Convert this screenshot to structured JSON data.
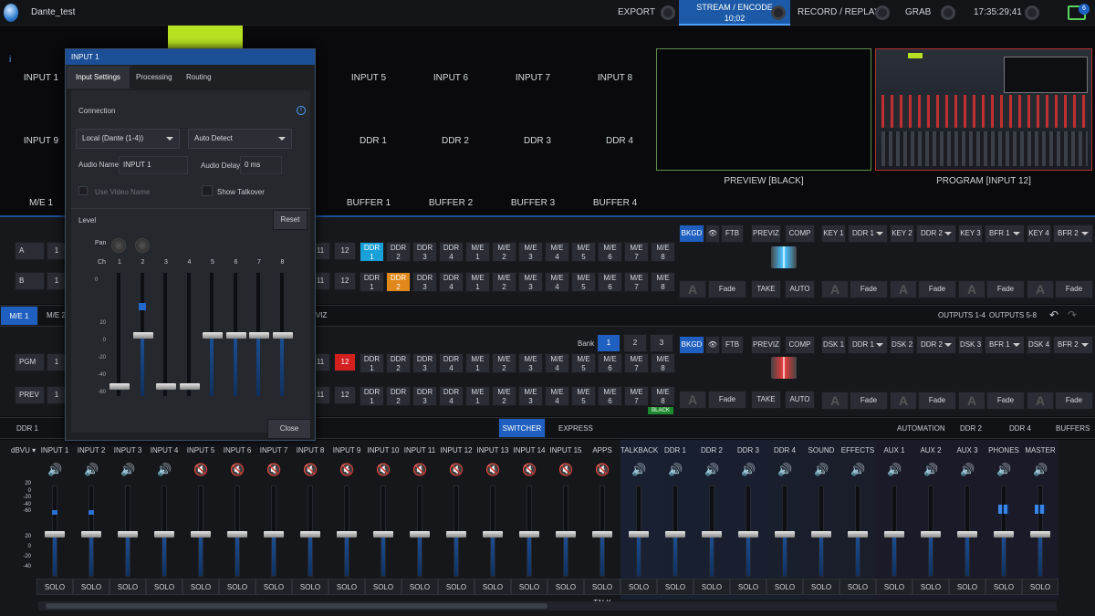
{
  "app": {
    "session": "Dante_test",
    "time": "17:35:29;41",
    "notifications": "6"
  },
  "topbar": {
    "export": "EXPORT",
    "stream_label": "STREAM / ENCODE",
    "stream_time": "10;02",
    "record": "RECORD / REPLAY",
    "grab": "GRAB"
  },
  "inputs_row1": [
    "INPUT 1",
    "INPUT 5",
    "INPUT 6",
    "INPUT 7",
    "INPUT 8"
  ],
  "inputs_row2": [
    "INPUT 9",
    "DDR 1",
    "DDR 2",
    "DDR 3",
    "DDR 4"
  ],
  "buffers": [
    "M/E 1",
    "BUFFER 1",
    "BUFFER 2",
    "BUFFER 3",
    "BUFFER 4"
  ],
  "monitors": {
    "preview": "PREVIEW [BLACK]",
    "program": "PROGRAM [INPUT 12]"
  },
  "dialog": {
    "title": "INPUT 1",
    "tabs": [
      "Input Settings",
      "Processing",
      "Routing"
    ],
    "connection": "Connection",
    "source": "Local (Dante (1-4))",
    "detect": "Auto Detect",
    "audio_name_label": "Audio Name",
    "audio_name": "INPUT 1",
    "audio_delay_label": "Audio Delay",
    "audio_delay": "0 ms",
    "use_video_name": "Use Video Name",
    "show_talkover": "Show Talkover",
    "level": "Level",
    "reset": "Reset",
    "pan": "Pan",
    "ch": "Ch",
    "channels": [
      "1",
      "2",
      "3",
      "4",
      "5",
      "6",
      "7",
      "8"
    ],
    "scale_top": [
      "0"
    ],
    "scale": [
      "20",
      "0",
      "-20",
      "-40",
      "-60"
    ],
    "close": "Close"
  },
  "me": {
    "rowA": "A",
    "rowB": "B",
    "one": "1",
    "eleven": "11",
    "twelve": "12",
    "srcs_top": [
      "DDR",
      "DDR",
      "DDR",
      "DDR",
      "M/E",
      "M/E",
      "M/E",
      "M/E",
      "M/E",
      "M/E",
      "M/E",
      "M/E"
    ],
    "srcs_bot": [
      "1",
      "2",
      "3",
      "4",
      "1",
      "2",
      "3",
      "4",
      "5",
      "6",
      "7",
      "8"
    ],
    "bkgd": "BKGD",
    "ftb": "FTB",
    "previz": "PREVIZ",
    "comp": "COMP",
    "take": "TAKE",
    "auto": "AUTO",
    "fade": "Fade",
    "keys": [
      {
        "k": "KEY 1",
        "s": "DDR 1"
      },
      {
        "k": "KEY 2",
        "s": "DDR 2"
      },
      {
        "k": "KEY 3",
        "s": "BFR 1"
      },
      {
        "k": "KEY 4",
        "s": "BFR 2"
      }
    ],
    "dsks": [
      {
        "k": "DSK 1",
        "s": "DDR 1"
      },
      {
        "k": "DSK 2",
        "s": "DDR 2"
      },
      {
        "k": "DSK 3",
        "s": "BFR 1"
      },
      {
        "k": "DSK 4",
        "s": "BFR 2"
      }
    ]
  },
  "tabsbar": {
    "me1": "M/E 1",
    "me2": "M/E 2",
    "viz": "VIZ",
    "outputs14": "OUTPUTS 1-4",
    "outputs58": "OUTPUTS 5-8"
  },
  "pgm": {
    "pgm": "PGM",
    "prev": "PREV",
    "bank": "Bank",
    "banks": [
      "1",
      "2",
      "3"
    ],
    "black": "BLACK"
  },
  "bottom": {
    "ddr1": "DDR 1",
    "switcher": "SWITCHER",
    "express": "EXPRESS",
    "automation": "AUTOMATION",
    "ddr2": "DDR 2",
    "ddr4": "DDR 4",
    "buffers": "BUFFERS"
  },
  "mixer": {
    "dbvu": "dBVU",
    "channels": [
      "INPUT 1",
      "INPUT 2",
      "INPUT 3",
      "INPUT 4",
      "INPUT 5",
      "INPUT 6",
      "INPUT 7",
      "INPUT 8",
      "INPUT 9",
      "INPUT 10",
      "INPUT 11",
      "INPUT 12",
      "INPUT 13",
      "INPUT 14",
      "INPUT 15",
      "APPS",
      "TALKBACK",
      "DDR 1",
      "DDR 2",
      "DDR 3",
      "DDR 4",
      "SOUND",
      "EFFECTS",
      "AUX 1",
      "AUX 2",
      "AUX 3",
      "PHONES",
      "MASTER"
    ],
    "muted": [
      false,
      false,
      false,
      false,
      true,
      true,
      true,
      true,
      true,
      true,
      true,
      true,
      true,
      true,
      true,
      true,
      false,
      false,
      false,
      false,
      false,
      false,
      false,
      false,
      false,
      false,
      false,
      false
    ],
    "solo": [
      "SOLO",
      "SOLO",
      "SOLO",
      "SOLO",
      "SOLO",
      "SOLO",
      "SOLO",
      "SOLO",
      "SOLO",
      "SOLO",
      "SOLO",
      "SOLO",
      "SOLO",
      "SOLO",
      "SOLO",
      "SOLO TALK",
      "SOLO",
      "SOLO",
      "SOLO",
      "SOLO",
      "SOLO",
      "SOLO",
      "SOLO",
      "SOLO",
      "SOLO",
      "SOLO",
      "SOLO",
      "SOLO"
    ],
    "scale_top": [
      "20",
      "0",
      "-20",
      "-40",
      "-60"
    ],
    "scale_bot": [
      "20",
      "0",
      "-20",
      "-40"
    ]
  },
  "colors": {
    "accent": "#1c5aa8",
    "ddr_cyan": "#1aa0d8",
    "ddr_orange": "#e0881a",
    "red": "#d41f1f",
    "green": "#5bd45b"
  }
}
